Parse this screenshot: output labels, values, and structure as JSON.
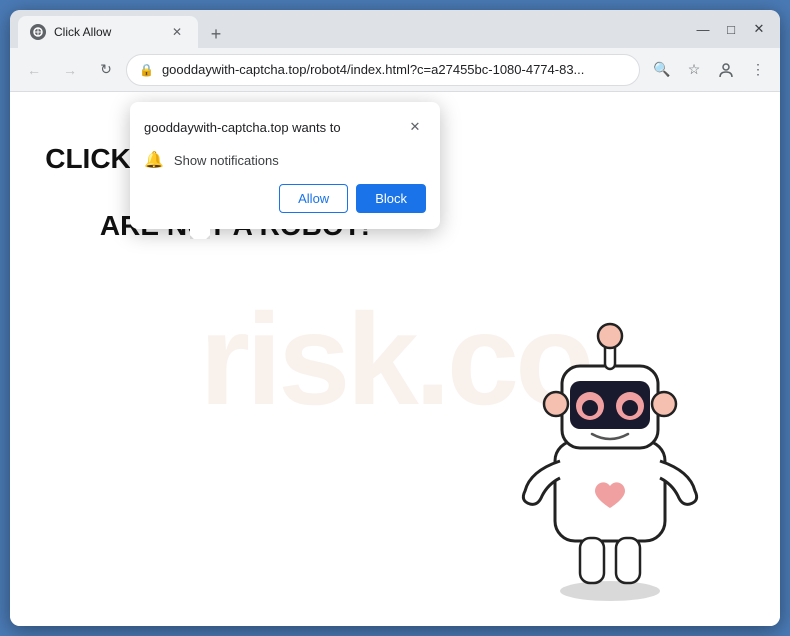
{
  "window": {
    "title": "Click Allow",
    "tab_title": "Click Allow",
    "close_label": "✕",
    "minimize_label": "—",
    "maximize_label": "□"
  },
  "address_bar": {
    "url": "gooddaywith-captcha.top/robot4/index.html?c=a27455bc-1080-4774-83...",
    "lock_icon": "🔒"
  },
  "nav": {
    "back_icon": "←",
    "forward_icon": "→",
    "refresh_icon": "↻"
  },
  "toolbar": {
    "search_icon": "🔍",
    "star_icon": "☆",
    "profile_icon": "👤",
    "menu_icon": "⋮",
    "download_icon": "⬇",
    "new_tab_icon": "+"
  },
  "notification_popup": {
    "title": "gooddaywith-captcha.top wants to",
    "close_icon": "✕",
    "notification_row_icon": "🔔",
    "notification_label": "Show notifications",
    "allow_button": "Allow",
    "block_button": "Block"
  },
  "page": {
    "headline_line1": "CLICK ALLOW TO CONFIRM THAT YOU",
    "headline_line2": "ARE NOT A ROBOT!"
  },
  "watermark": {
    "text": "risk.co"
  }
}
